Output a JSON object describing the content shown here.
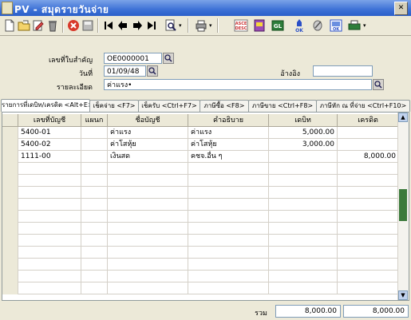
{
  "window": {
    "title": "PV - สมุดรายวันจ่าย",
    "close_label": "✕"
  },
  "toolbar": {
    "buttons": [
      {
        "name": "new-doc-icon"
      },
      {
        "name": "open-folder-icon"
      },
      {
        "name": "edit-icon"
      },
      {
        "name": "delete-icon"
      },
      {
        "name": "cancel-icon"
      },
      {
        "name": "save-icon"
      },
      {
        "name": "first-record-icon"
      },
      {
        "name": "previous-record-icon"
      },
      {
        "name": "next-record-icon"
      },
      {
        "name": "last-record-icon"
      },
      {
        "name": "search-icon"
      },
      {
        "name": "print-icon"
      },
      {
        "name": "sort-ascend-descend-icon"
      },
      {
        "name": "journal-icon"
      },
      {
        "name": "gl-icon"
      },
      {
        "name": "ok-approve-icon"
      },
      {
        "name": "attach-icon"
      },
      {
        "name": "ok-post-icon"
      },
      {
        "name": "printer-menu-icon"
      }
    ],
    "sort_label": "ASCE DESC",
    "gl_label": "GL",
    "ok_label": "OK"
  },
  "form": {
    "doc_no_label": "เลขที่ใบสำคัญ",
    "doc_no_value": "OE0000001",
    "date_label": "วันที่",
    "date_value": "01/09/48",
    "ref_label": "อ้างอิง",
    "ref_value": "",
    "detail_label": "รายละเอียด",
    "detail_value": "ค่าแรง•"
  },
  "tabs": [
    "รายการที่เดบิท/เครดิต <Alt+E>",
    "เช็คจ่าย <F7>",
    "เช็ครับ <Ctrl+F7>",
    "ภาษีซื้อ <F8>",
    "ภาษีขาย <Ctrl+F8>",
    "ภาษีหัก ณ ที่จ่าย <Ctrl+F10>"
  ],
  "grid": {
    "headers": [
      "เลขที่บัญชี",
      "แผนก",
      "ชื่อบัญชี",
      "คำอธิบาย",
      "เดบิท",
      "เครดิต"
    ],
    "rows": [
      [
        "5400-01",
        "",
        "ค่าแรง",
        "ค่าแรง",
        "5,000.00",
        ""
      ],
      [
        "5400-02",
        "",
        "ค่าโสหุ้ย",
        "ค่าโสหุ้ย",
        "3,000.00",
        ""
      ],
      [
        "1111-00",
        "",
        "เงินสด",
        "คชจ.อื่น ๆ",
        "",
        "8,000.00"
      ]
    ]
  },
  "totals": {
    "label": "รวม",
    "debit": "8,000.00",
    "credit": "8,000.00"
  }
}
